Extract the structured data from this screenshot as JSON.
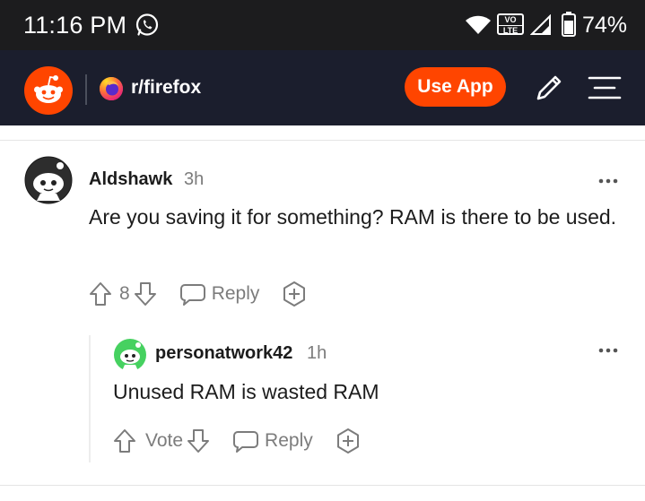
{
  "status_bar": {
    "time": "11:16 PM",
    "volte_top": "VO",
    "volte_bottom": "LTE",
    "battery": "74%"
  },
  "header": {
    "subreddit": "r/firefox",
    "use_app": "Use App",
    "accent": "#ff4500"
  },
  "comments": [
    {
      "author": "Aldshawk",
      "time": "3h",
      "body": "Are you saving it for something? RAM is there to be used.",
      "score": "8",
      "reply_label": "Reply"
    },
    {
      "author": "personatwork42",
      "time": "1h",
      "body": "Unused RAM is wasted RAM",
      "score": "Vote",
      "reply_label": "Reply"
    }
  ]
}
